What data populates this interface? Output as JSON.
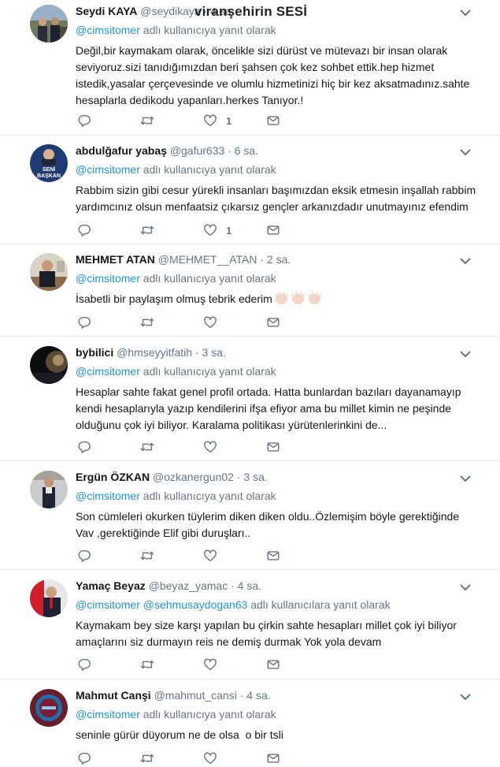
{
  "watermark": "viranşehirin SESİ",
  "reply_suffix": "adlı kullanıcıya yanıt olarak",
  "reply_suffix_plural": "adlı kullanıcılara yanıt olarak",
  "tweets": [
    {
      "name": "Seydi KAYA",
      "handle": "@seydikaya",
      "time": "· 4 sa.",
      "reply_to": [
        "@cimsitomer"
      ],
      "text": "Değil,bir kaymakam olarak, öncelikle sizi dürüst ve mütevazı bir insan olarak seviyoruz.sizi tanıdığımızdan beri şahsen çok kez sohbet ettik.hep hizmet istedik,yasalar çerçevesinde ve olumlu hizmetinizi hiç bir kez aksatmadınız.sahte hesaplarla dedikodu yapanları.herkes Tanıyor.!",
      "likes": "1"
    },
    {
      "name": "abdulğafur yabaş",
      "handle": "@gafur633",
      "time": "· 6 sa.",
      "reply_to": [
        "@cimsitomer"
      ],
      "text": "Rabbim sizin gibi cesur yürekli insanları başımızdan eksik etmesin inşallah rabbim yardımcınız olsun menfaatsiz çıkarsız gençler arkanızdadır unutmayınız efendim",
      "likes": "1",
      "avatar_text": [
        "SENİ",
        "BAŞKAN"
      ]
    },
    {
      "name": "MEHMET ATAN",
      "handle": "@MEHMET__ATAN",
      "time": "· 2 sa.",
      "reply_to": [
        "@cimsitomer"
      ],
      "text": "İsabetli bir paylaşım olmuş tebrik ederim",
      "likes": ""
    },
    {
      "name": "bybilici",
      "handle": "@hmseyyitfatih",
      "time": "· 3 sa.",
      "reply_to": [
        "@cimsitomer"
      ],
      "text": "Hesaplar sahte fakat genel profil ortada. Hatta bunlardan bazıları dayanamayıp kendi hesaplarıyla yazıp kendilerini ifşa efiyor ama bu millet kimin ne peşinde olduğunu çok iyi biliyor. Karalama politikası yürütenlerinkini de...",
      "likes": ""
    },
    {
      "name": "Ergün ÖZKAN",
      "handle": "@ozkanergun02",
      "time": "· 3 sa.",
      "reply_to": [
        "@cimsitomer"
      ],
      "text": "Son cümleleri okurken tüylerim diken diken oldu..Özlemişim böyle gerektiğinde Vav ,gerektiğinde Elif gibi duruşları..",
      "likes": ""
    },
    {
      "name": "Yamaç Beyaz",
      "handle": "@beyaz_yamac",
      "time": "· 4 sa.",
      "reply_to": [
        "@cimsitomer",
        "@sehmusaydogan63"
      ],
      "text": "Kaymakam bey size karşı yapılan bu çirkin sahte hesapları millet çok iyi biliyor amaçlarını siz durmayın reis ne demiş durmak Yok yola devam",
      "likes": ""
    },
    {
      "name": "Mahmut Canşi",
      "handle": "@mahmut_cansi",
      "time": "· 4 sa.",
      "reply_to": [
        "@cimsitomer"
      ],
      "text": "seninle gürür düyorum ne de olsa  o bir tsli",
      "likes": ""
    }
  ],
  "icons": {
    "reply": "reply-icon",
    "retweet": "retweet-icon",
    "like": "heart-icon",
    "dm": "envelope-icon",
    "more": "chevron-down-icon",
    "emoji": "clapping-hands-emoji"
  },
  "colors": {
    "link": "#1b95e0",
    "muted": "#657786",
    "text": "#14171a",
    "divider": "#e6ecf0"
  }
}
